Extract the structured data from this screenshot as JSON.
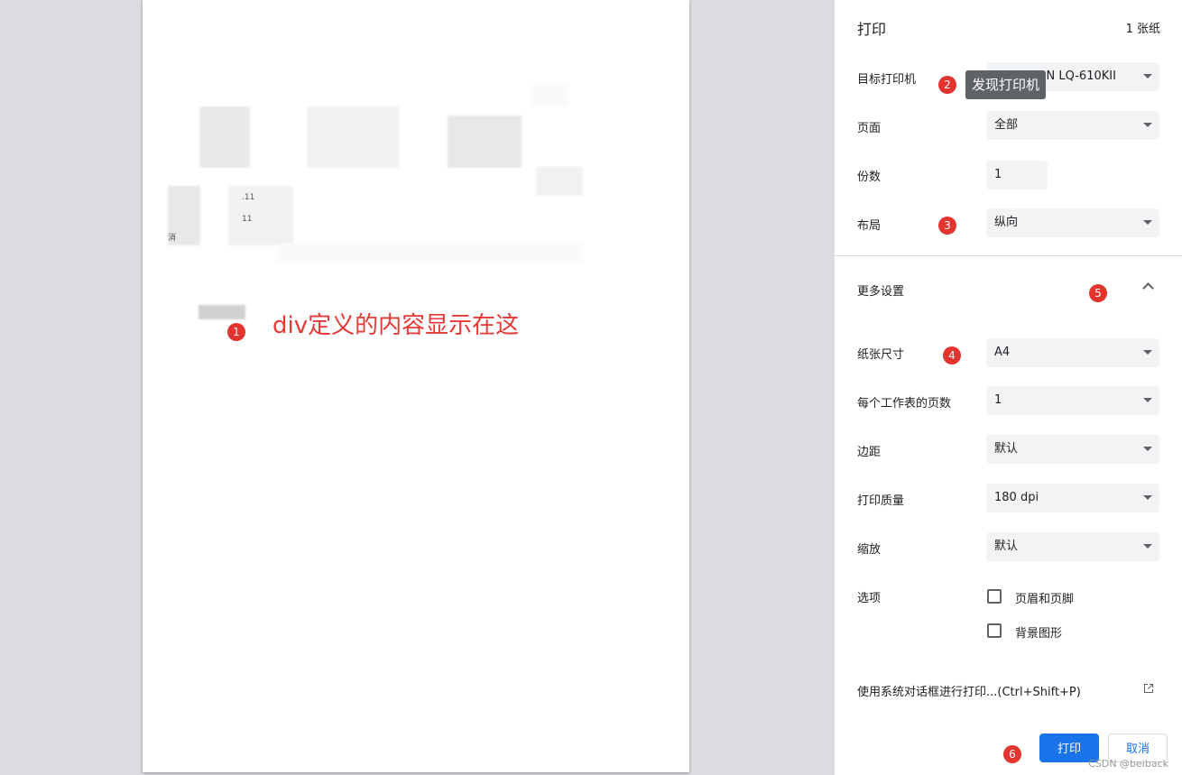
{
  "header": {
    "title": "打印",
    "sheets": "1 张纸"
  },
  "settings": {
    "destination": {
      "label": "目标打印机",
      "value": "EPSON LQ-610KII"
    },
    "pages": {
      "label": "页面",
      "value": "全部"
    },
    "copies": {
      "label": "份数",
      "value": "1"
    },
    "layout": {
      "label": "布局",
      "value": "纵向"
    },
    "more_settings": {
      "label": "更多设置"
    },
    "paper_size": {
      "label": "纸张尺寸",
      "value": "A4"
    },
    "pages_per_sheet": {
      "label": "每个工作表的页数",
      "value": "1"
    },
    "margins": {
      "label": "边距",
      "value": "默认"
    },
    "quality": {
      "label": "打印质量",
      "value": "180 dpi"
    },
    "scale": {
      "label": "缩放",
      "value": "默认"
    },
    "options": {
      "label": "选项",
      "headers_footers": "页眉和页脚",
      "background_graphics": "背景图形"
    },
    "system_dialog": "使用系统对话框进行打印...(Ctrl+Shift+P)"
  },
  "buttons": {
    "print": "打印",
    "cancel": "取消"
  },
  "tooltip": "发现打印机",
  "preview": {
    "caption": "div定义的内容显示在这",
    "fragment_text": "消",
    "fragment_11a": ".11",
    "fragment_11b": "11"
  },
  "annotations": [
    "1",
    "2",
    "3",
    "4",
    "5",
    "6"
  ],
  "watermark": "CSDN @beiback",
  "colors": {
    "accent": "#1a73e8",
    "annotation": "#e3342f"
  }
}
